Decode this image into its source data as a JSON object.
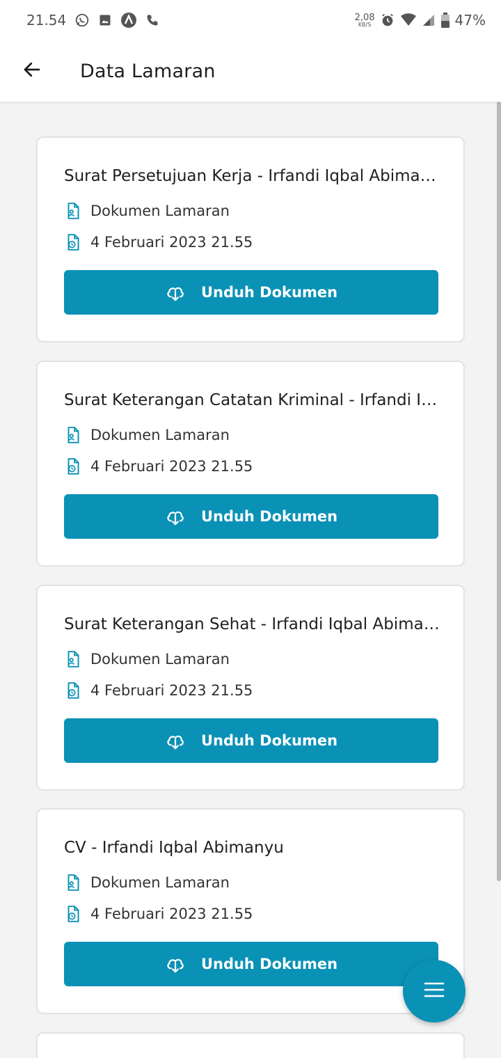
{
  "status_bar": {
    "time": "21.54",
    "net_speed_value": "2,08",
    "net_speed_unit": "KB/S",
    "battery": "47%",
    "icons": [
      "whatsapp-icon",
      "gallery-icon",
      "app-a-icon",
      "phone-icon",
      "alarm-icon",
      "wifi-icon",
      "signal-icon",
      "battery-icon"
    ]
  },
  "app_bar": {
    "title": "Data Lamaran",
    "back_icon": "arrow-left-icon"
  },
  "colors": {
    "accent": "#0a91b6",
    "background": "#f3f3f3",
    "card": "#ffffff"
  },
  "documents": [
    {
      "title": "Surat Persetujuan Kerja - Irfandi Iqbal Abimanyu",
      "type": "Dokumen Lamaran",
      "date": "4 Februari 2023 21.55",
      "button": "Unduh Dokumen"
    },
    {
      "title": "Surat Keterangan Catatan Kriminal - Irfandi Iqbal Abimanyu",
      "type": "Dokumen Lamaran",
      "date": "4 Februari 2023 21.55",
      "button": "Unduh Dokumen"
    },
    {
      "title": "Surat Keterangan Sehat - Irfandi Iqbal Abimanyu",
      "type": "Dokumen Lamaran",
      "date": "4 Februari 2023 21.55",
      "button": "Unduh Dokumen"
    },
    {
      "title": "CV - Irfandi Iqbal Abimanyu",
      "type": "Dokumen Lamaran",
      "date": "4 Februari 2023 21.55",
      "button": "Unduh Dokumen"
    }
  ],
  "fab_icon": "menu-icon"
}
